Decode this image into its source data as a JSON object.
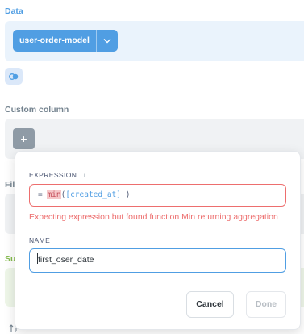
{
  "sections": {
    "data": {
      "title": "Data",
      "table": "user-order-model"
    },
    "custom_column": {
      "title": "Custom column",
      "add_symbol": "+"
    },
    "filter": {
      "title": "Fil"
    },
    "summarize": {
      "title": "Su"
    }
  },
  "popover": {
    "expression_label": "EXPRESSION",
    "info_symbol": "i",
    "expression": {
      "eq": "= ",
      "fn": "min",
      "open": "(",
      "field": "[created_at]",
      "close": " )"
    },
    "error": "Expecting expression but found function Min returning aggregation",
    "name_label": "NAME",
    "name_value": "first_oser_date",
    "cancel_label": "Cancel",
    "done_label": "Done"
  },
  "colors": {
    "brand": "#509ee3",
    "error": "#ed6e6e",
    "summarize": "#84bb4c"
  },
  "icons": {
    "table_chevron": "chevron-down-icon",
    "toggle": "toggle-icon",
    "info": "info-icon",
    "sort": "sort-icon"
  }
}
